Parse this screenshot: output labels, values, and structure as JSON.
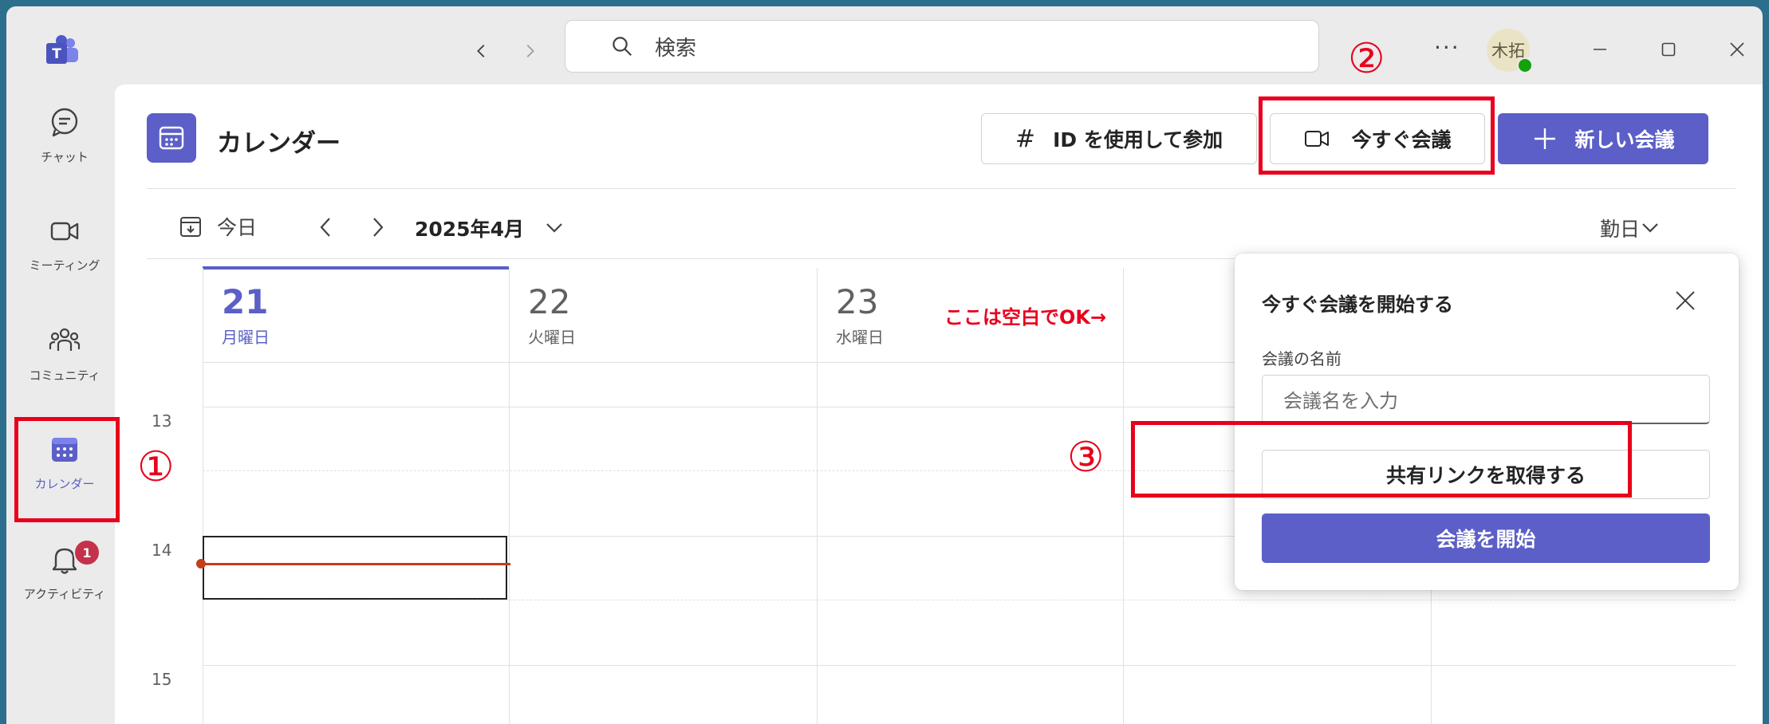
{
  "titlebar": {
    "search_placeholder": "検索",
    "more_label": "···",
    "avatar_initials": "木拓"
  },
  "rail": {
    "items": [
      {
        "label": "チャット",
        "icon": "chat-icon"
      },
      {
        "label": "ミーティング",
        "icon": "video-icon"
      },
      {
        "label": "コミュニティ",
        "icon": "people-community-icon"
      },
      {
        "label": "カレンダー",
        "icon": "calendar-icon",
        "active": true
      },
      {
        "label": "アクティビティ",
        "icon": "bell-icon",
        "badge": "1"
      }
    ]
  },
  "header": {
    "title": "カレンダー",
    "join_id_label": "ID を使用して参加",
    "meet_now_label": "今すぐ会議",
    "new_meeting_label": "新しい会議"
  },
  "toolbar": {
    "today_label": "今日",
    "month_label": "2025年4月",
    "view_label": "勤日"
  },
  "days": [
    {
      "num": "21",
      "name": "月曜日",
      "today": true
    },
    {
      "num": "22",
      "name": "火曜日"
    },
    {
      "num": "23",
      "name": "水曜日"
    }
  ],
  "hours": [
    "13",
    "14",
    "15"
  ],
  "popup": {
    "title": "今すぐ会議を開始する",
    "field_label": "会議の名前",
    "field_placeholder": "会議名を入力",
    "share_link_label": "共有リンクを取得する",
    "start_label": "会議を開始"
  },
  "annotations": {
    "step1": "①",
    "step2": "②",
    "step3": "③",
    "note": "ここは空白でOK→"
  },
  "colors": {
    "accent": "#5b5fc7",
    "annotation_red": "#e8001c",
    "background": "#2b6f8c"
  }
}
